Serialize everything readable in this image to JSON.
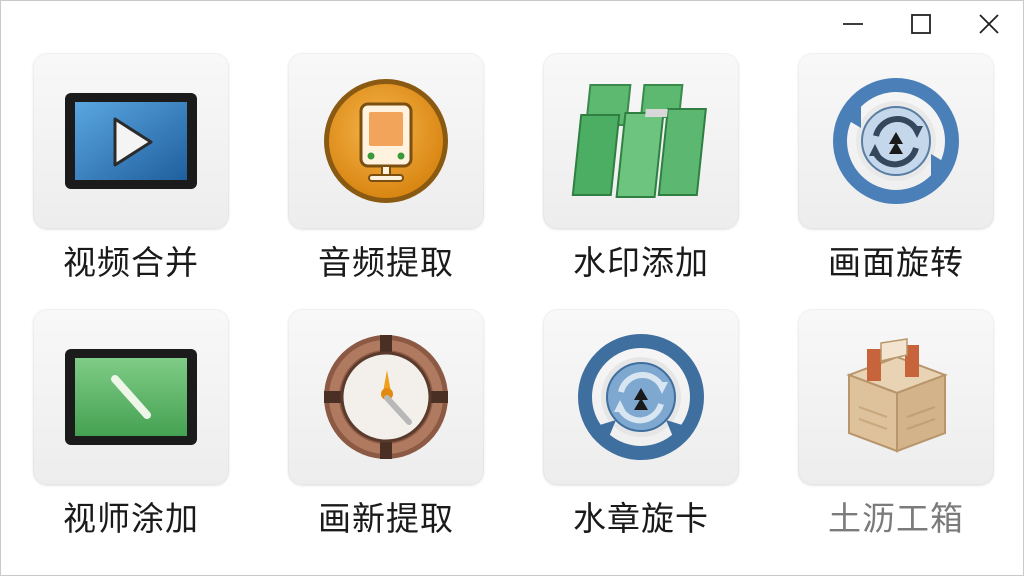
{
  "window_controls": {
    "minimize": "minimize",
    "maximize": "maximize",
    "close": "close"
  },
  "tools": [
    {
      "label": "视频合并",
      "icon": "video-play-icon"
    },
    {
      "label": "音频提取",
      "icon": "audio-player-icon"
    },
    {
      "label": "水印添加",
      "icon": "watermark-panels-icon"
    },
    {
      "label": "画面旋转",
      "icon": "rotate-arrows-icon"
    },
    {
      "label": "视师涂加",
      "icon": "green-screen-icon"
    },
    {
      "label": "画新提取",
      "icon": "compass-icon"
    },
    {
      "label": "水章旋卡",
      "icon": "rotate-globe-icon"
    },
    {
      "label": "土沥工箱",
      "icon": "toolbox-icon"
    }
  ]
}
